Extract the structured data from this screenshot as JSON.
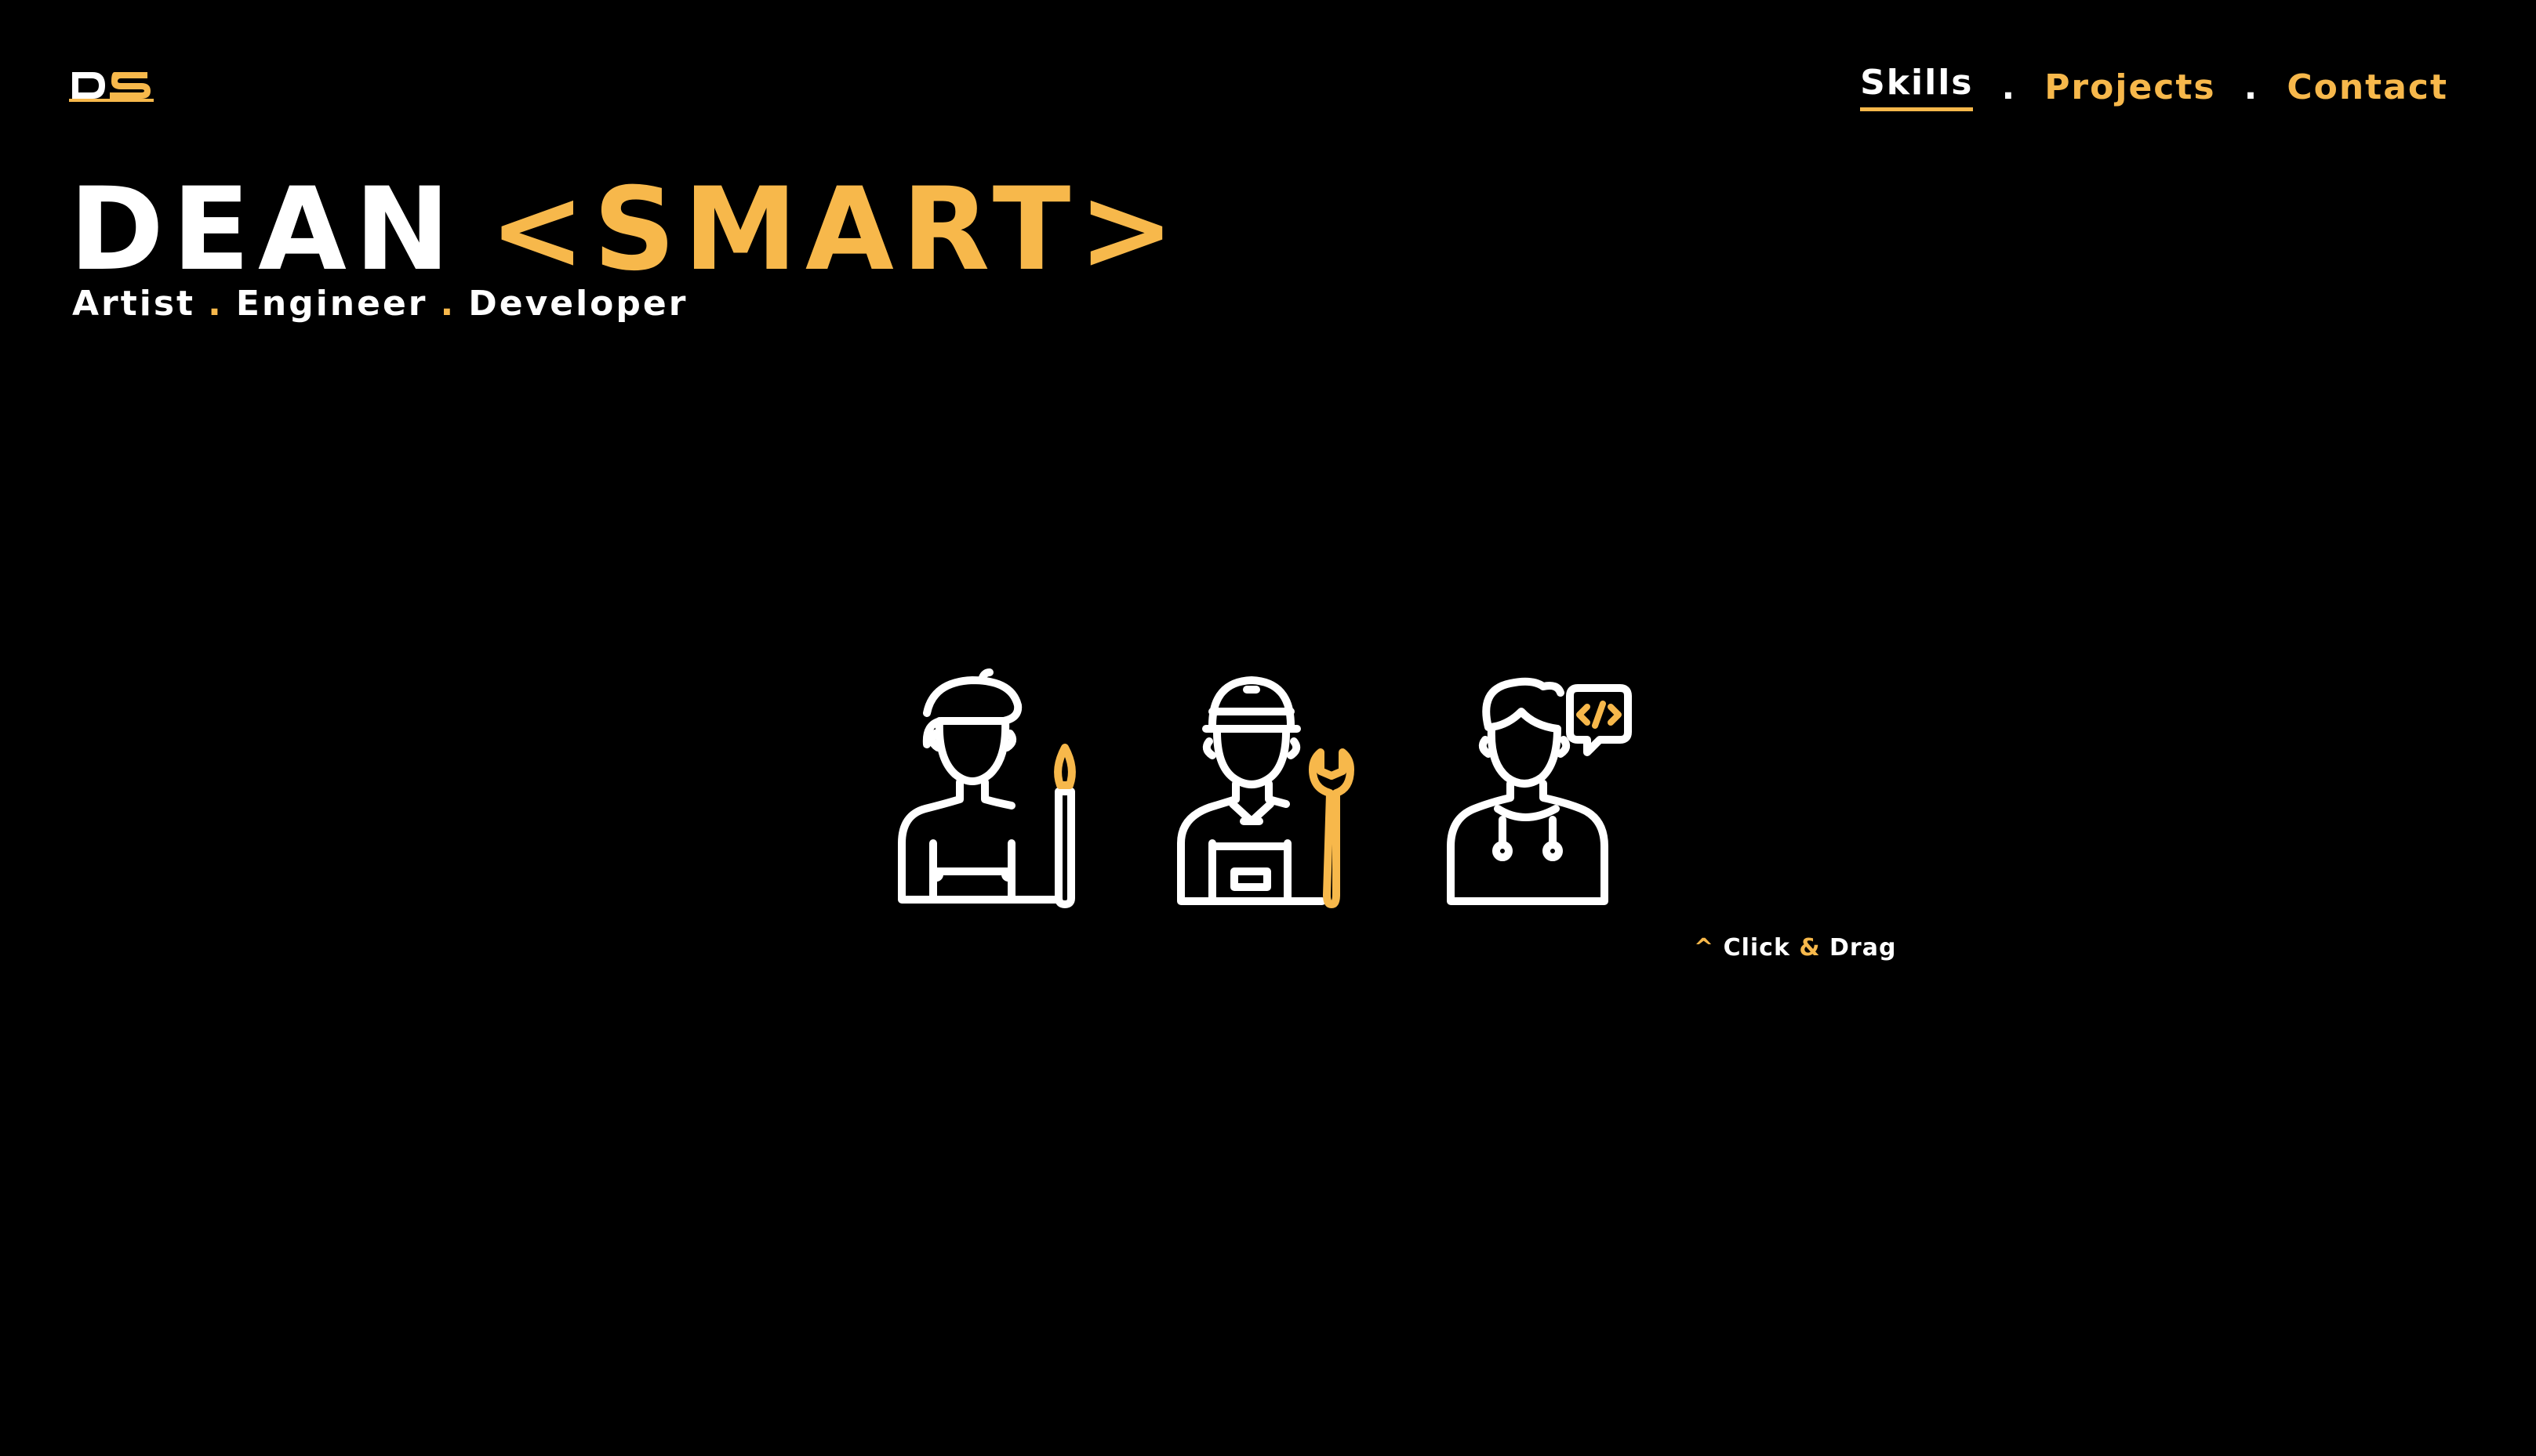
{
  "brand": {
    "logo_text": "DS",
    "accent_color": "#f7b84b",
    "background_color": "#000000"
  },
  "nav": {
    "items": [
      {
        "label": "Skills",
        "active": true
      },
      {
        "label": "Projects",
        "active": false
      },
      {
        "label": "Contact",
        "active": false
      }
    ],
    "separator": "."
  },
  "hero": {
    "first_name": "DEAN",
    "last_name": "<SMART>",
    "roles": [
      "Artist",
      "Engineer",
      "Developer"
    ],
    "role_separator": "."
  },
  "skills": {
    "figures": [
      {
        "icon": "artist-icon"
      },
      {
        "icon": "engineer-icon"
      },
      {
        "icon": "developer-icon"
      }
    ]
  },
  "hint": {
    "caret": "^",
    "word1": "Click",
    "amp": "&",
    "word2": "Drag"
  }
}
